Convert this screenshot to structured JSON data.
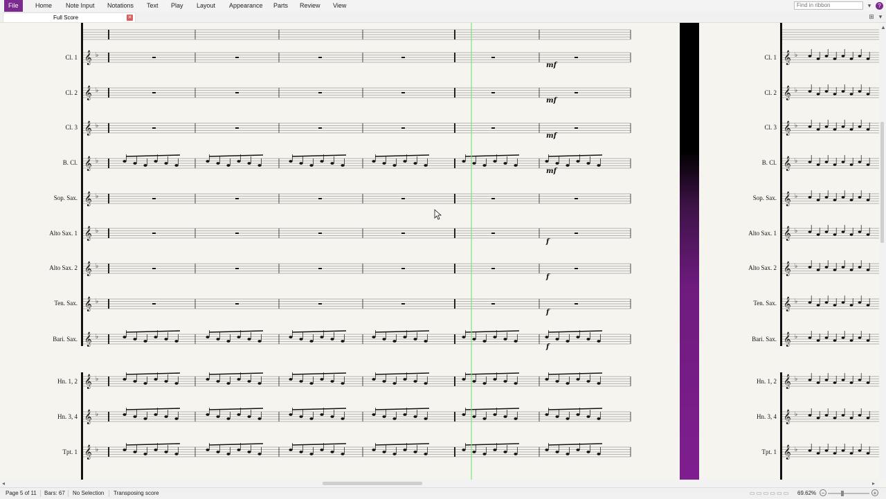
{
  "ribbon": {
    "tabs": [
      "File",
      "Home",
      "Note Input",
      "Notations",
      "Text",
      "Play",
      "Layout",
      "Appearance",
      "Parts",
      "Review",
      "View"
    ],
    "find_placeholder": "Find in ribbon",
    "help_icon": "question-icon"
  },
  "document_tab": {
    "title": "Full Score",
    "close_icon": "close-icon"
  },
  "score": {
    "instruments": [
      "Cl. 1",
      "Cl. 2",
      "Cl. 3",
      "B. Cl.",
      "Sop. Sax.",
      "Alto Sax. 1",
      "Alto Sax. 2",
      "Ten. Sax.",
      "Bari. Sax.",
      "Hn. 1, 2",
      "Hn. 3, 4",
      "Tpt. 1"
    ],
    "dynamics": [
      "mf",
      "mf",
      "mf",
      "mf",
      "f",
      "f",
      "f",
      "f"
    ],
    "page_divider_color": "#7f1e8f",
    "playback_line_color": "#7fe07f"
  },
  "status": {
    "page": "Page 5 of 11",
    "bars": "Bars: 67",
    "selection": "No Selection",
    "mode": "Transposing score",
    "zoom": "69.62%"
  }
}
